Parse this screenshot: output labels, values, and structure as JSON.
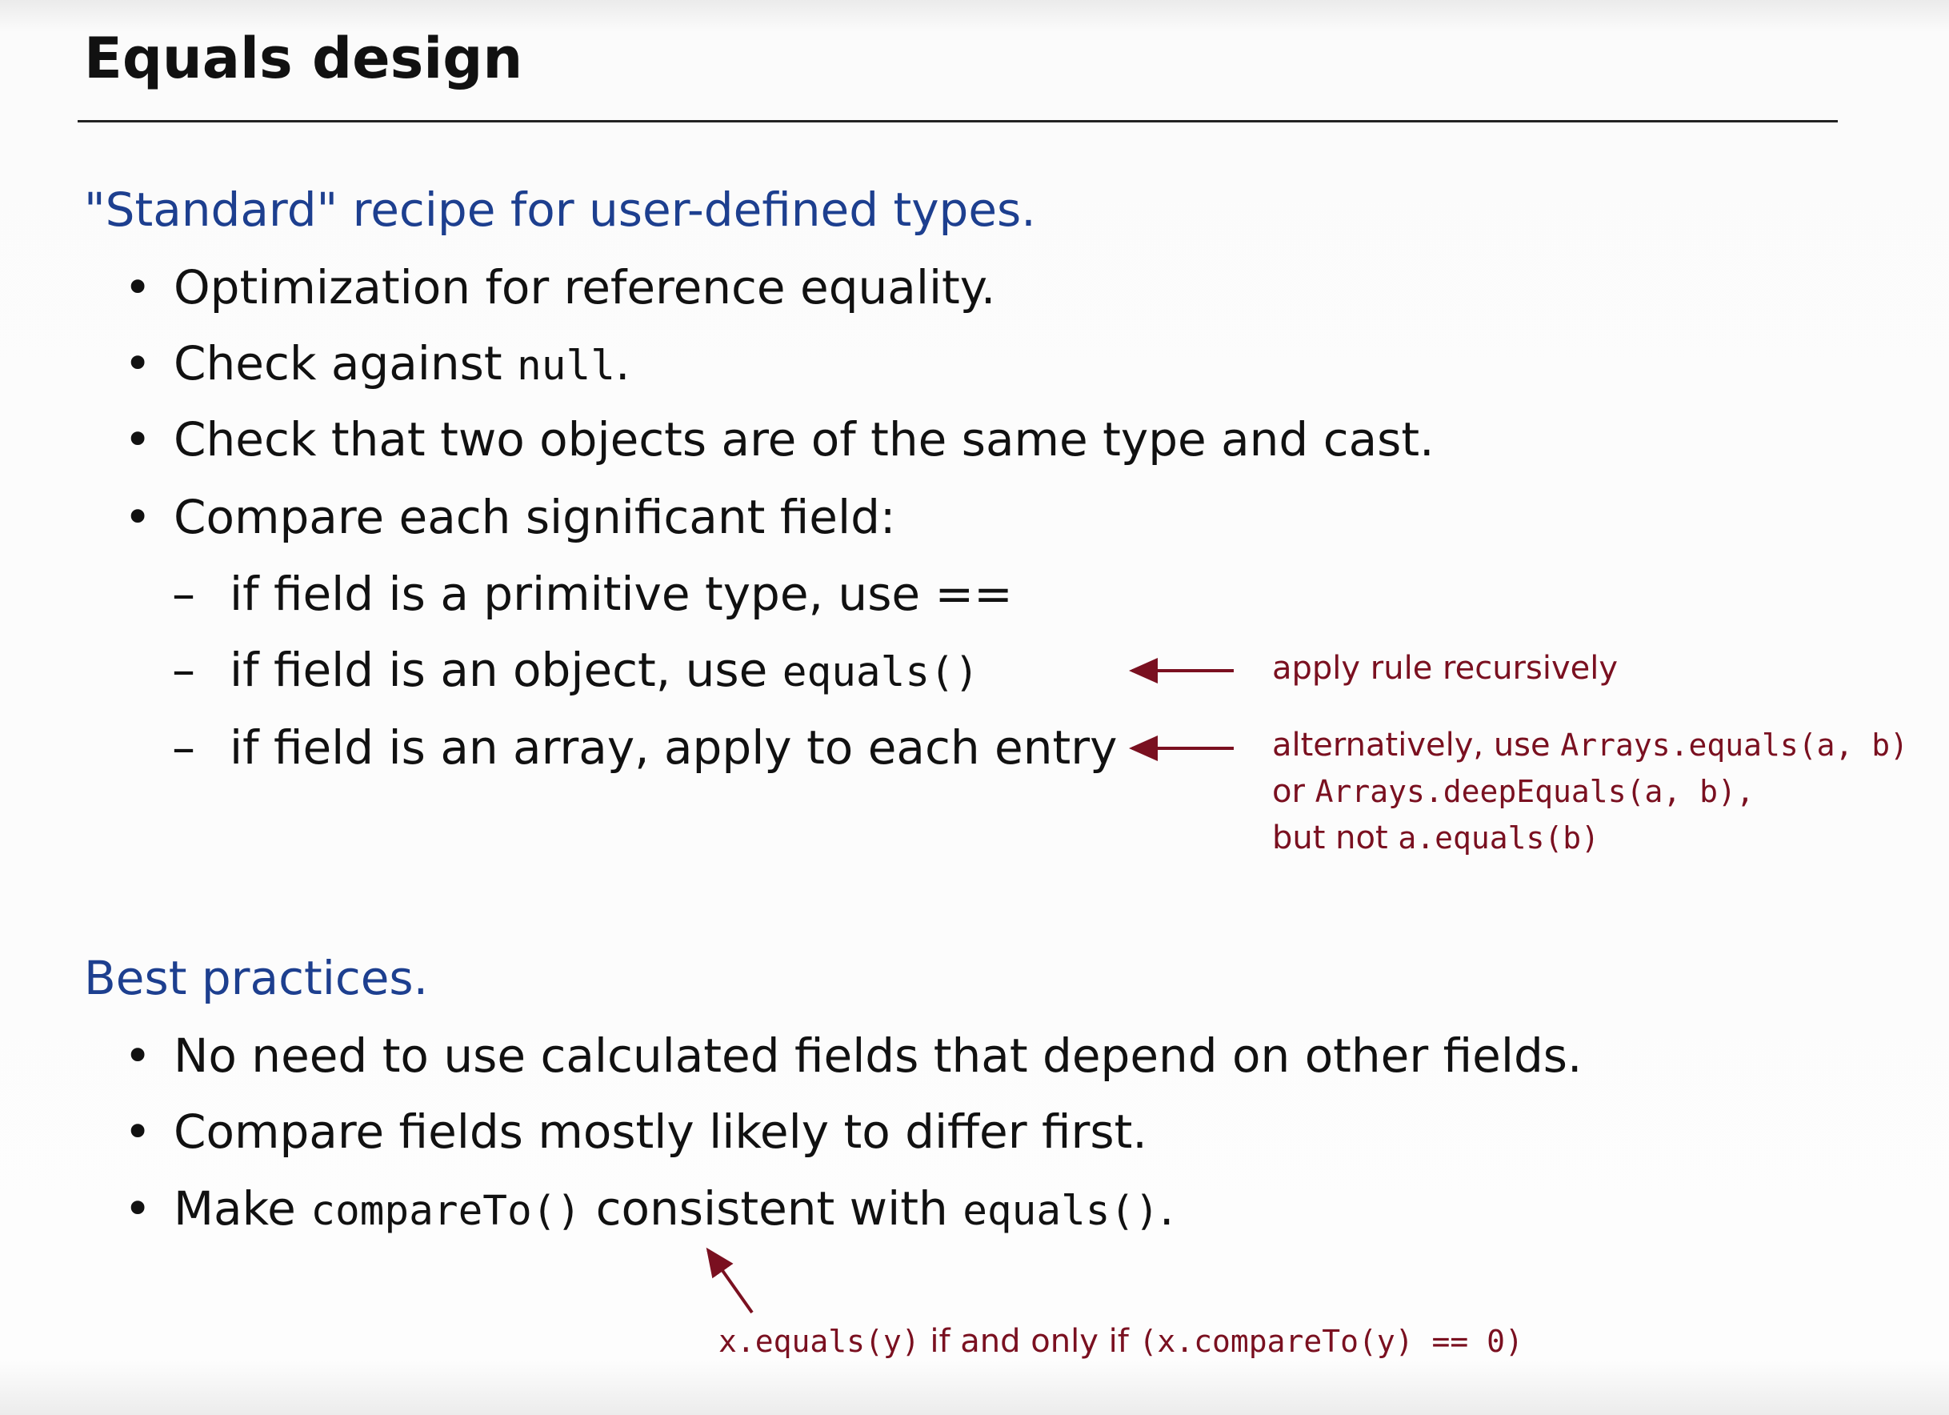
{
  "title": "Equals design",
  "section1": {
    "heading": "\"Standard\" recipe for user-defined types.",
    "bullets": [
      {
        "text": "Optimization for reference equality."
      },
      {
        "text": "Check against ",
        "code": "null",
        "suffix": "."
      },
      {
        "text": "Check that two objects are of the same type and cast."
      },
      {
        "text": "Compare each significant field:"
      }
    ],
    "subbullets": [
      {
        "text": "if field is a primitive type, use =="
      },
      {
        "text": "if field is an object, use ",
        "code": "equals()"
      },
      {
        "text": "if field is an array, apply to each entry"
      }
    ],
    "notes": {
      "object": "apply rule recursively",
      "array_line1_text": "alternatively, use ",
      "array_line1_code": "Arrays.equals(a, b)",
      "array_line2_text": "or ",
      "array_line2_code": "Arrays.deepEquals(a, b),",
      "array_line3_text": "but not ",
      "array_line3_code": "a.equals(b)"
    }
  },
  "section2": {
    "heading": "Best practices.",
    "bullets": [
      {
        "text": "No need to use calculated fields that depend on other fields."
      },
      {
        "text": "Compare fields mostly likely to differ first."
      },
      {
        "text": "Make ",
        "code": "compareTo()",
        "middle": " consistent with ",
        "code2": "equals()",
        "suffix": "."
      }
    ],
    "note": {
      "code1": "x.equals(y)",
      "text": " if and only if ",
      "code2": "(x.compareTo(y) == 0)"
    }
  },
  "colors": {
    "heading": "#1d3f8f",
    "annotation": "#7a1020",
    "text": "#111111"
  },
  "icons": [
    "bullet-dot",
    "dash",
    "arrow-left",
    "arrow-up-left"
  ]
}
